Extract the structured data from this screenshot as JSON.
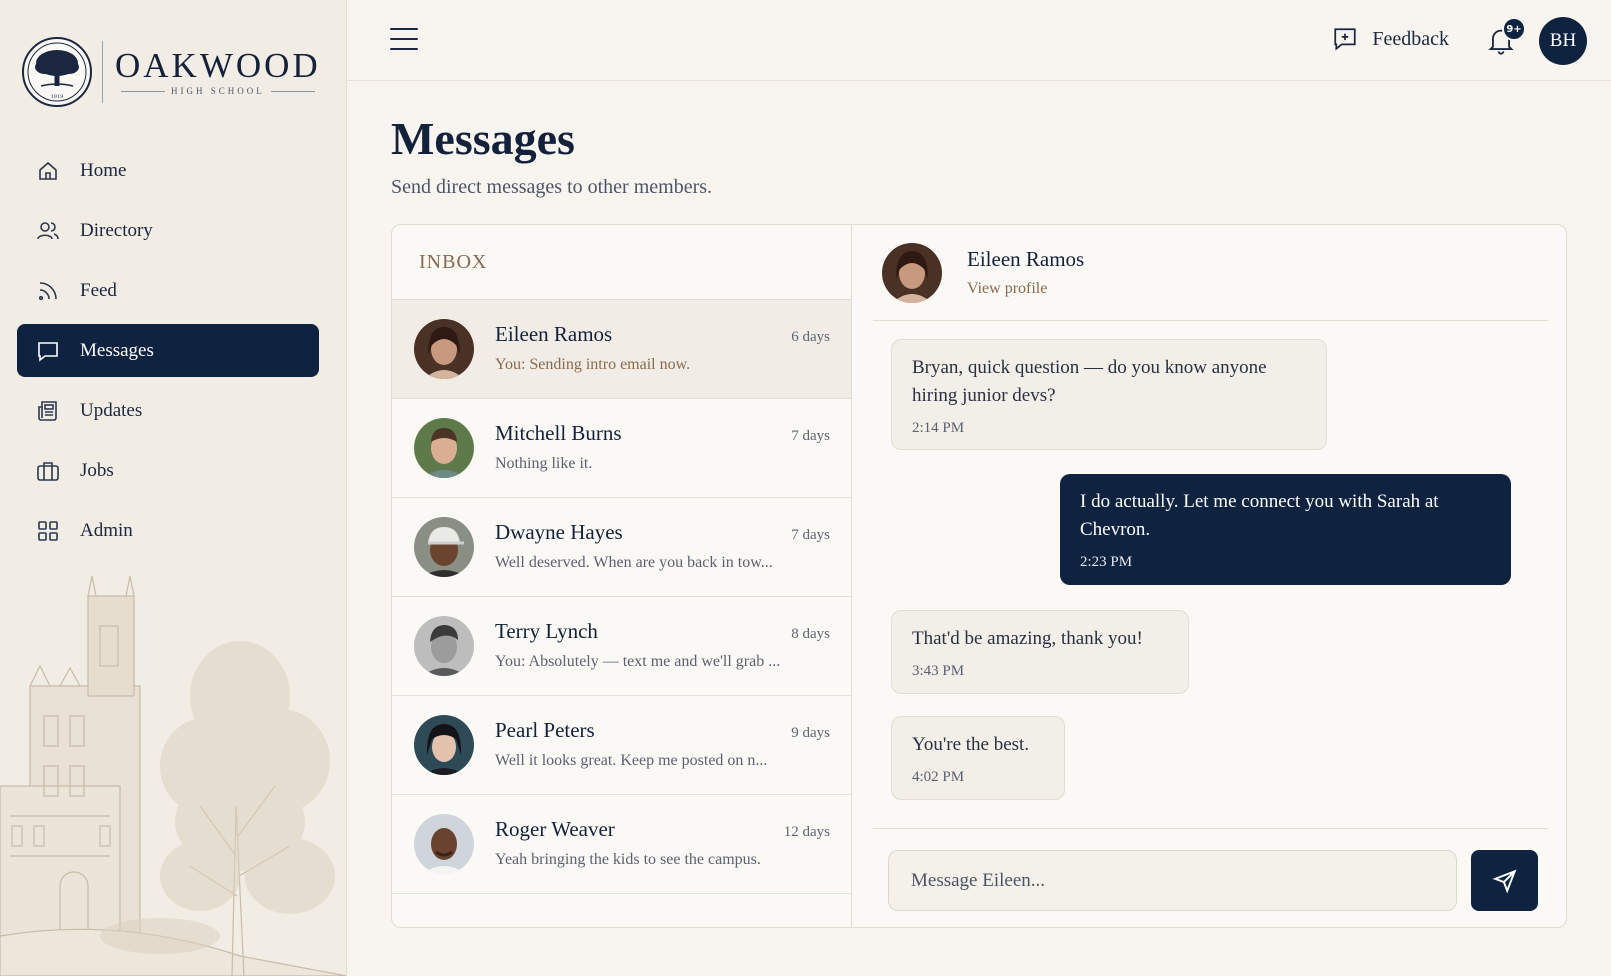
{
  "brand": {
    "name": "OAKWOOD",
    "subtitle": "HIGH SCHOOL",
    "seal_year": "1919"
  },
  "sidebar": {
    "items": [
      {
        "label": "Home",
        "icon": "home-icon"
      },
      {
        "label": "Directory",
        "icon": "users-icon"
      },
      {
        "label": "Feed",
        "icon": "rss-icon"
      },
      {
        "label": "Messages",
        "icon": "message-icon",
        "active": true
      },
      {
        "label": "Updates",
        "icon": "newspaper-icon"
      },
      {
        "label": "Jobs",
        "icon": "briefcase-icon"
      },
      {
        "label": "Admin",
        "icon": "grid-icon"
      }
    ]
  },
  "topbar": {
    "feedback_label": "Feedback",
    "notification_badge": "9+",
    "user_initials": "BH"
  },
  "page": {
    "title": "Messages",
    "subtitle": "Send direct messages to other members."
  },
  "inbox": {
    "heading": "INBOX",
    "conversations": [
      {
        "name": "Eileen Ramos",
        "time": "6 days",
        "preview": "You: Sending intro email now.",
        "active": true
      },
      {
        "name": "Mitchell Burns",
        "time": "7 days",
        "preview": "Nothing like it."
      },
      {
        "name": "Dwayne Hayes",
        "time": "7 days",
        "preview": "Well deserved. When are you back in tow..."
      },
      {
        "name": "Terry Lynch",
        "time": "8 days",
        "preview": "You: Absolutely — text me and we'll grab ..."
      },
      {
        "name": "Pearl Peters",
        "time": "9 days",
        "preview": "Well it looks great. Keep me posted on n..."
      },
      {
        "name": "Roger Weaver",
        "time": "12 days",
        "preview": "Yeah bringing the kids to see the campus."
      }
    ]
  },
  "chat": {
    "contact_name": "Eileen Ramos",
    "profile_link": "View profile",
    "messages": [
      {
        "text": "Bryan, quick question — do you know anyone hiring junior devs?",
        "time": "2:14 PM",
        "direction": "in"
      },
      {
        "text": "I do actually. Let me connect you with Sarah at Chevron.",
        "time": "2:23 PM",
        "direction": "out"
      },
      {
        "text": "That'd be amazing, thank you!",
        "time": "3:43 PM",
        "direction": "in"
      },
      {
        "text": "You're the best.",
        "time": "4:02 PM",
        "direction": "in"
      }
    ],
    "composer_placeholder": "Message Eileen..."
  },
  "colors": {
    "navy": "#0f2340",
    "accent_brown": "#8a6a4c",
    "background": "#f8f5f0",
    "sidebar_bg": "#f1ece4"
  }
}
